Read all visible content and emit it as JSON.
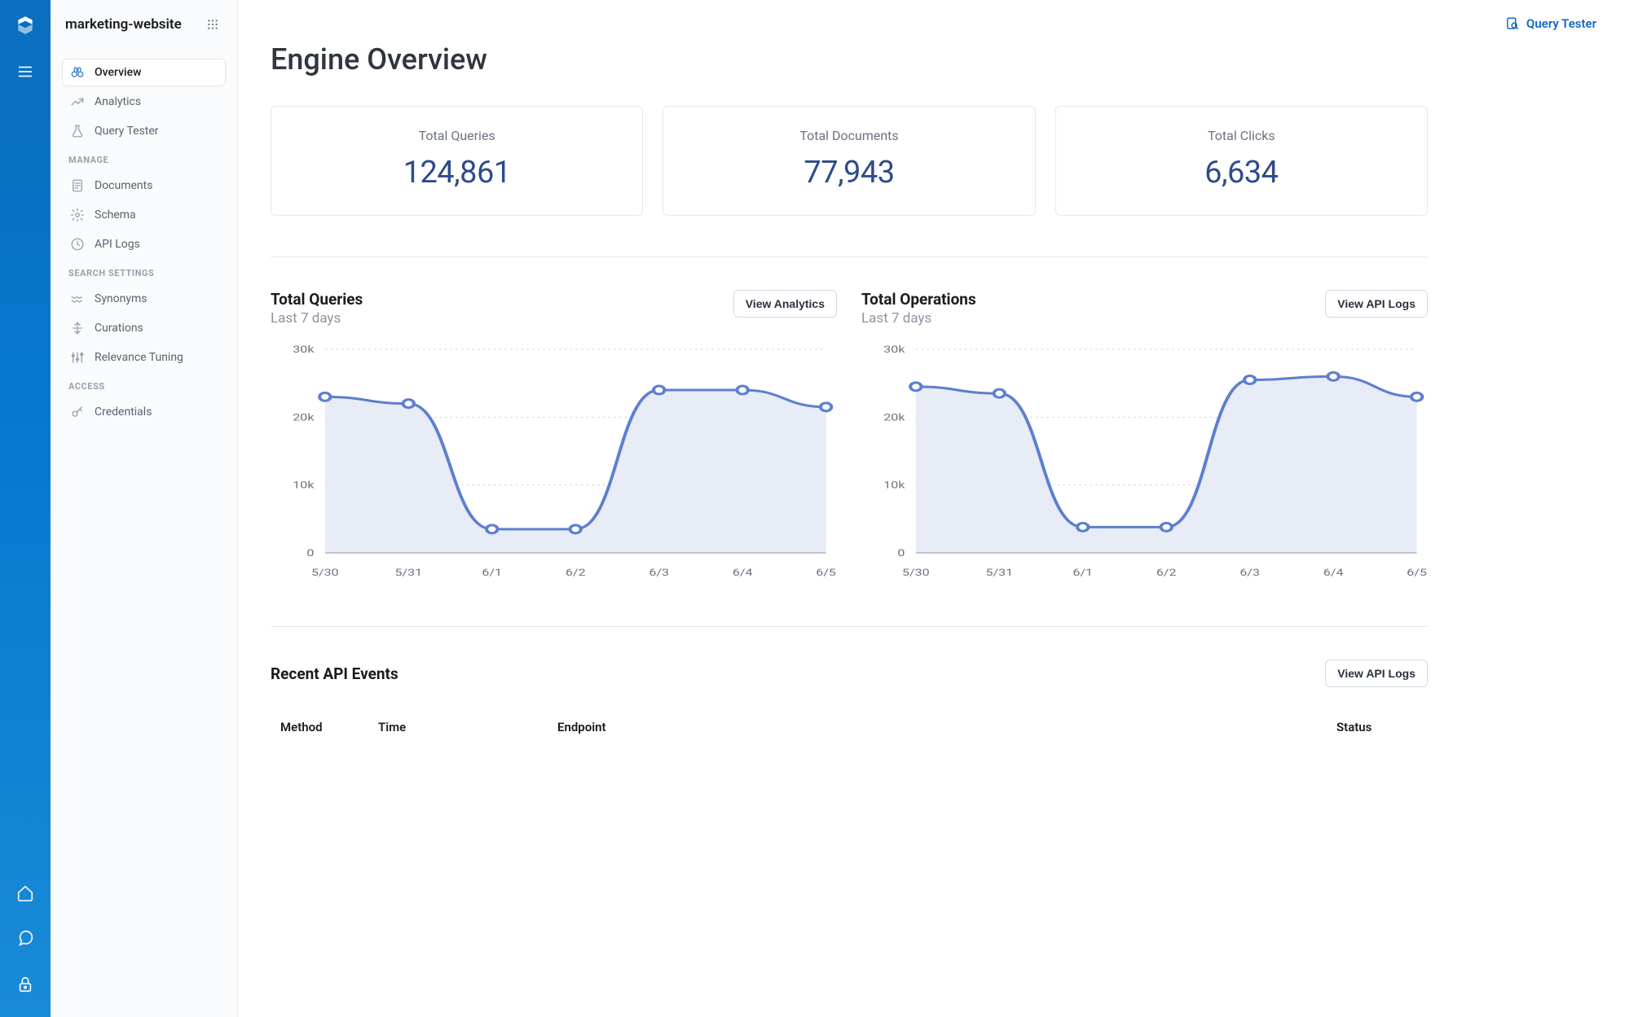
{
  "rail": {
    "icons": [
      "logo",
      "menu",
      "home",
      "chat",
      "lock"
    ]
  },
  "sidebar": {
    "title": "marketing-website",
    "groups": [
      {
        "label": null,
        "items": [
          {
            "id": "overview",
            "label": "Overview",
            "icon": "binoculars",
            "active": true
          },
          {
            "id": "analytics",
            "label": "Analytics",
            "icon": "trend"
          },
          {
            "id": "query-tester",
            "label": "Query Tester",
            "icon": "flask"
          }
        ]
      },
      {
        "label": "MANAGE",
        "items": [
          {
            "id": "documents",
            "label": "Documents",
            "icon": "doc"
          },
          {
            "id": "schema",
            "label": "Schema",
            "icon": "gear"
          },
          {
            "id": "api-logs",
            "label": "API Logs",
            "icon": "clock"
          }
        ]
      },
      {
        "label": "SEARCH SETTINGS",
        "items": [
          {
            "id": "synonyms",
            "label": "Synonyms",
            "icon": "waves"
          },
          {
            "id": "curations",
            "label": "Curations",
            "icon": "arrows"
          },
          {
            "id": "relevance",
            "label": "Relevance Tuning",
            "icon": "sliders"
          }
        ]
      },
      {
        "label": "ACCESS",
        "items": [
          {
            "id": "credentials",
            "label": "Credentials",
            "icon": "key"
          }
        ]
      }
    ]
  },
  "header": {
    "query_tester": "Query Tester"
  },
  "page": {
    "title": "Engine Overview"
  },
  "metrics": [
    {
      "label": "Total Queries",
      "value": "124,861"
    },
    {
      "label": "Total Documents",
      "value": "77,943"
    },
    {
      "label": "Total Clicks",
      "value": "6,634"
    }
  ],
  "charts": [
    {
      "title": "Total Queries",
      "subtitle": "Last 7 days",
      "button": "View Analytics"
    },
    {
      "title": "Total Operations",
      "subtitle": "Last 7 days",
      "button": "View API Logs"
    }
  ],
  "events": {
    "title": "Recent API Events",
    "button": "View API Logs",
    "columns": [
      "Method",
      "Time",
      "Endpoint",
      "Status"
    ]
  },
  "chart_data": [
    {
      "type": "line",
      "title": "Total Queries",
      "subtitle": "Last 7 days",
      "xlabel": "",
      "ylabel": "",
      "ylim": [
        0,
        30000
      ],
      "yticks": [
        0,
        10000,
        20000,
        30000
      ],
      "ytick_labels": [
        "0",
        "10k",
        "20k",
        "30k"
      ],
      "categories": [
        "5/30",
        "5/31",
        "6/1",
        "6/2",
        "6/3",
        "6/4",
        "6/5"
      ],
      "values": [
        23000,
        22000,
        3500,
        3500,
        24000,
        24000,
        21500
      ]
    },
    {
      "type": "line",
      "title": "Total Operations",
      "subtitle": "Last 7 days",
      "xlabel": "",
      "ylabel": "",
      "ylim": [
        0,
        30000
      ],
      "yticks": [
        0,
        10000,
        20000,
        30000
      ],
      "ytick_labels": [
        "0",
        "10k",
        "20k",
        "30k"
      ],
      "categories": [
        "5/30",
        "5/31",
        "6/1",
        "6/2",
        "6/3",
        "6/4",
        "6/5"
      ],
      "values": [
        24500,
        23500,
        3800,
        3800,
        25500,
        26000,
        23000
      ]
    }
  ]
}
